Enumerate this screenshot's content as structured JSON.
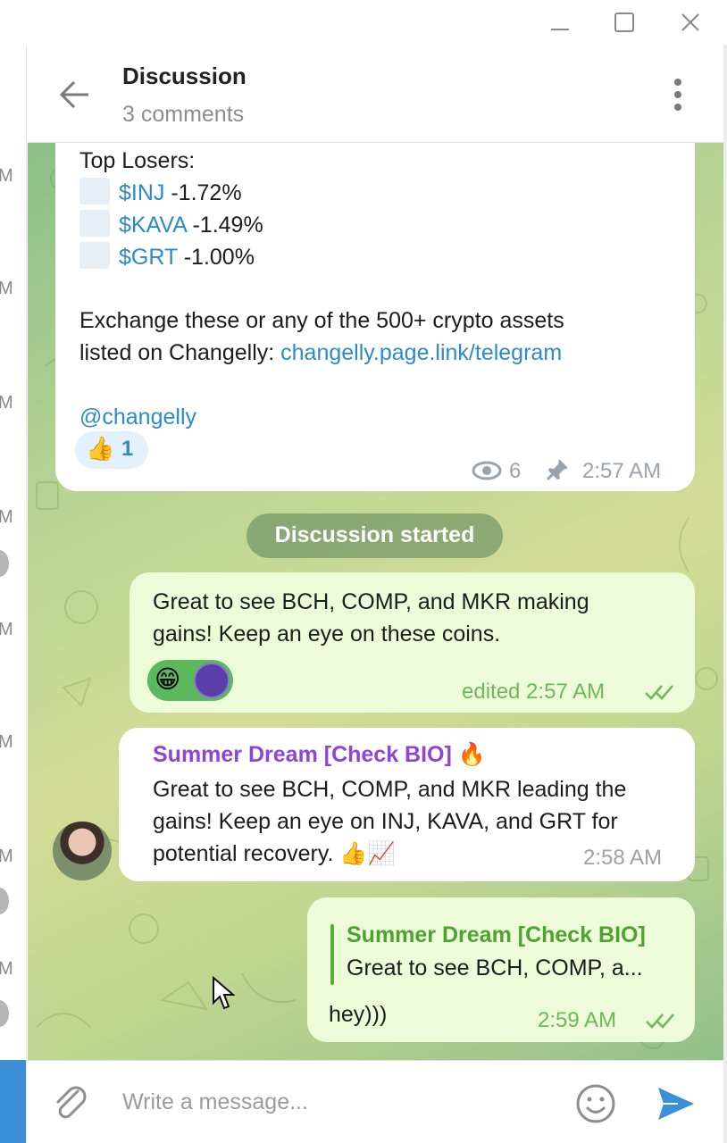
{
  "window": {
    "controls": [
      "minimize",
      "maximize",
      "close"
    ]
  },
  "left_list": {
    "time_suffixes": [
      "M",
      "M",
      "M",
      "M",
      "M",
      "M",
      "M",
      "M"
    ]
  },
  "header": {
    "title": "Discussion",
    "subtitle": "3 comments"
  },
  "channel_post": {
    "top_losers_title": "Top Losers:",
    "losers": [
      {
        "ticker": "$INJ",
        "change": " -1.72%"
      },
      {
        "ticker": "$KAVA",
        "change": " -1.49%"
      },
      {
        "ticker": "$GRT",
        "change": " -1.00%"
      }
    ],
    "exchange_line1": "Exchange these or any of the 500+ crypto assets",
    "exchange_line2": "listed on Changelly: ",
    "exchange_link": "changelly.page.link/telegram",
    "mention": "@changelly",
    "reaction_emoji": "👍",
    "reaction_count": "1",
    "views": "6",
    "time": "2:57 AM"
  },
  "service_message": "Discussion started",
  "messages": [
    {
      "line1": "Great to see BCH, COMP, and MKR making",
      "line2": "gains! Keep an eye on these coins.",
      "reaction_emoji": "😁",
      "meta": "edited 2:57 AM"
    },
    {
      "sender": "Summer Dream [Check BIO]",
      "sender_emoji": "🔥",
      "line1": "Great to see BCH, COMP, and MKR leading the",
      "line2": "gains! Keep an eye on INJ, KAVA, and GRT for",
      "line3": "potential recovery. ",
      "line3_emojis": "👍📈",
      "time": "2:58 AM"
    },
    {
      "reply_sender": "Summer Dream [Check BIO]",
      "reply_text": "Great to see BCH, COMP, a...",
      "text": "hey)))",
      "time": "2:59 AM"
    }
  ],
  "composer": {
    "placeholder": "Write a message..."
  },
  "colors": {
    "link": "#2c8acb",
    "sender_purple": "#8e44d6",
    "reply_green": "#4ea133",
    "outgoing_bubble": "#eefbd9",
    "meta_green": "#6db85a",
    "send_blue": "#3a8fd6"
  }
}
